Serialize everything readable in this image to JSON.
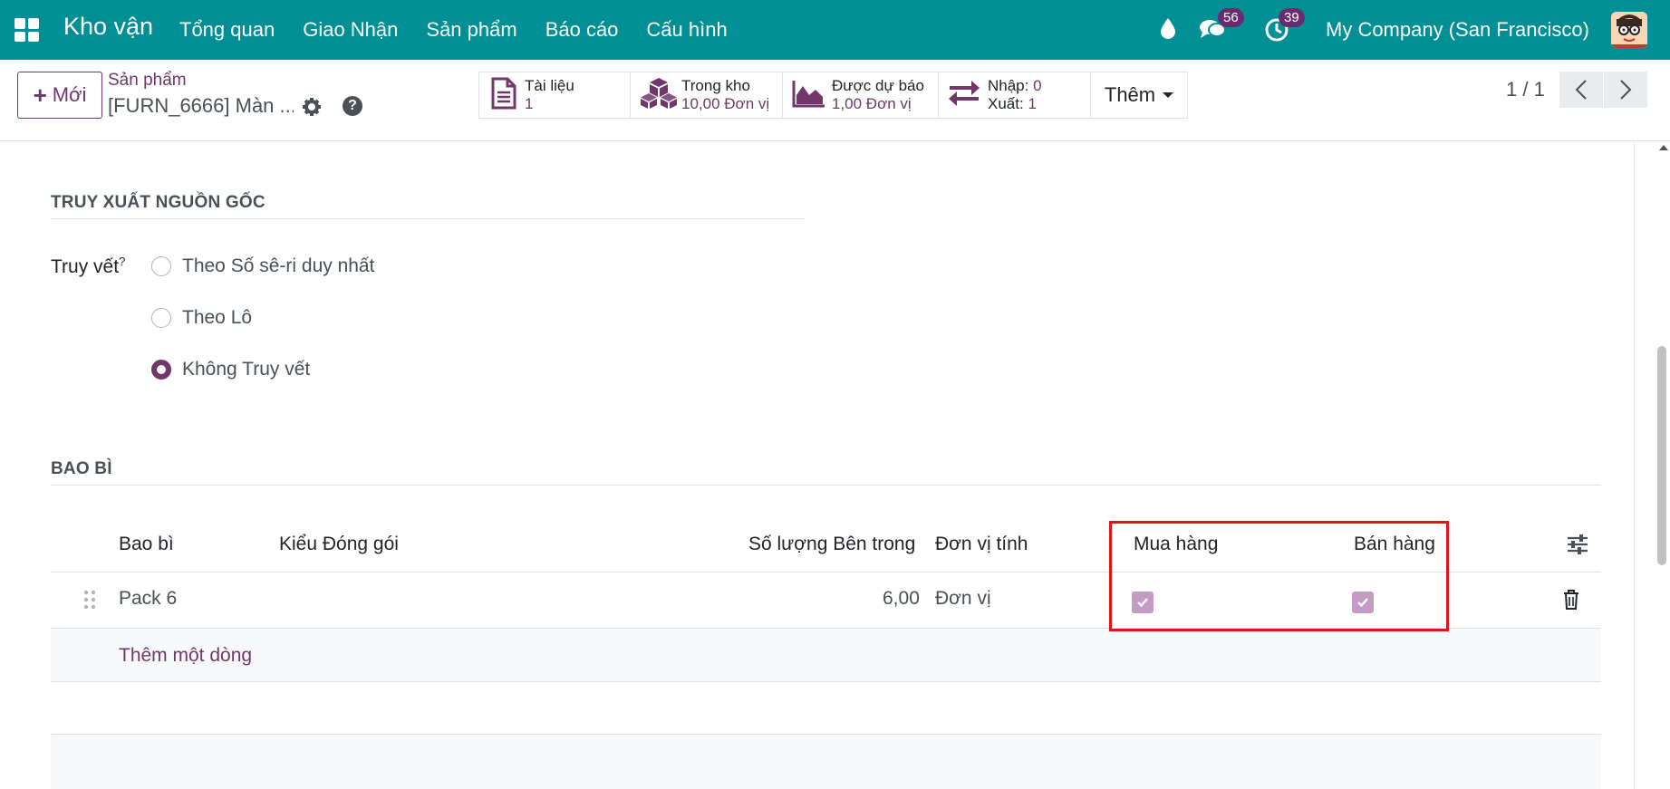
{
  "navbar": {
    "brand": "Kho vận",
    "menu": [
      "Tổng quan",
      "Giao Nhận",
      "Sản phẩm",
      "Báo cáo",
      "Cấu hình"
    ],
    "messages_count": "56",
    "activities_count": "39",
    "company": "My Company (San Francisco)"
  },
  "control": {
    "new_label": "Mới",
    "breadcrumb_parent": "Sản phẩm",
    "breadcrumb_current": "[FURN_6666] Màn ...",
    "smart_buttons": [
      {
        "label": "Tài liệu",
        "value": "1"
      },
      {
        "label": "Trong kho",
        "value": "10,00 Đơn vị"
      },
      {
        "label": "Được dự báo",
        "value": "1,00 Đơn vị"
      },
      {
        "label_in": "Nhập:",
        "value_in": "0",
        "label_out": "Xuất:",
        "value_out": "1"
      }
    ],
    "more_label": "Thêm",
    "pager": "1 / 1"
  },
  "traceability": {
    "section_title": "TRUY XUẤT NGUỒN GỐC",
    "field_label": "Truy vết",
    "field_help": "?",
    "options": [
      {
        "label": "Theo Số sê-ri duy nhất",
        "checked": false
      },
      {
        "label": "Theo Lô",
        "checked": false
      },
      {
        "label": "Không Truy vết",
        "checked": true
      }
    ]
  },
  "packaging": {
    "section_title": "BAO BÌ",
    "columns": [
      "Bao bì",
      "Kiểu Đóng gói",
      "Số lượng Bên trong",
      "Đơn vị tính",
      "Mua hàng",
      "Bán hàng"
    ],
    "rows": [
      {
        "name": "Pack 6",
        "type": "",
        "qty": "6,00",
        "uom": "Đơn vị",
        "purchase": true,
        "sales": true
      }
    ],
    "add_line": "Thêm một dòng"
  },
  "colors": {
    "navbar": "#008f95",
    "primary": "#71376b",
    "highlight": "#e0141b"
  }
}
